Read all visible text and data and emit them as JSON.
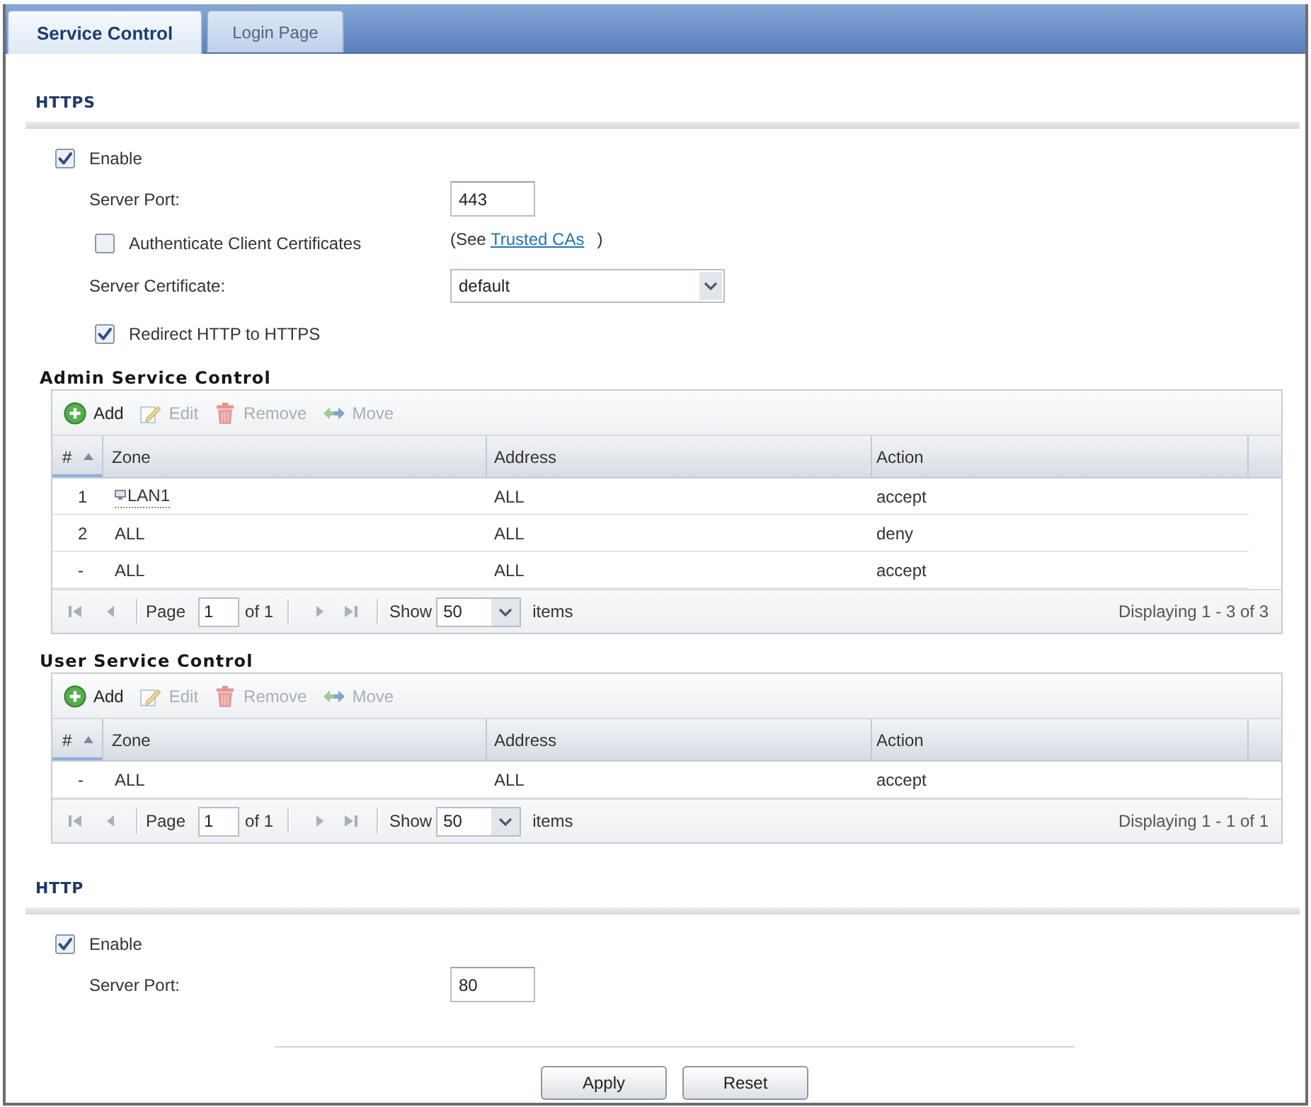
{
  "tabs": [
    {
      "label": "Service Control",
      "selected": true
    },
    {
      "label": "Login Page",
      "selected": false
    }
  ],
  "https": {
    "title": "HTTPS",
    "enable": {
      "label": "Enable",
      "checked": true
    },
    "server_port": {
      "label": "Server Port:",
      "value": "443"
    },
    "authenticate_client_certificates": {
      "label": "Authenticate Client Certificates",
      "checked": false,
      "note": {
        "prefix": "(See",
        "link": "Trusted CAs",
        "suffix": ")"
      }
    },
    "server_certificate": {
      "label": "Server Certificate:",
      "value": "default"
    },
    "redirect_http_to_https": {
      "label": "Redirect HTTP to HTTPS",
      "checked": true
    }
  },
  "admin_service_control": {
    "title": "Admin Service Control",
    "toolbar": [
      {
        "kind": "add",
        "label": "Add",
        "disabled": false
      },
      {
        "kind": "edit",
        "label": "Edit",
        "disabled": true
      },
      {
        "kind": "remove",
        "label": "Remove",
        "disabled": true
      },
      {
        "kind": "move",
        "label": "Move",
        "disabled": true
      }
    ],
    "columns": [
      {
        "label": "#",
        "sorted": true
      },
      {
        "label": "Zone",
        "sorted": false
      },
      {
        "label": "Address",
        "sorted": false
      },
      {
        "label": "Action",
        "sorted": false
      }
    ],
    "rows": [
      {
        "number": "1",
        "zone": "LAN1",
        "zone_object": true,
        "address": "ALL",
        "action": "accept"
      },
      {
        "number": "2",
        "zone": "ALL",
        "zone_object": false,
        "address": "ALL",
        "action": "deny"
      },
      {
        "number": "-",
        "zone": "ALL",
        "zone_object": false,
        "address": "ALL",
        "action": "accept"
      }
    ],
    "pager": {
      "page_label": "Page",
      "page": "1",
      "page_count": "of 1",
      "show_label": "Show",
      "show": "50",
      "items_label": "items",
      "summary": "Displaying 1 - 3 of 3"
    }
  },
  "user_service_control": {
    "title": "User Service Control",
    "toolbar": [
      {
        "kind": "add",
        "label": "Add",
        "disabled": false
      },
      {
        "kind": "edit",
        "label": "Edit",
        "disabled": true
      },
      {
        "kind": "remove",
        "label": "Remove",
        "disabled": true
      },
      {
        "kind": "move",
        "label": "Move",
        "disabled": true
      }
    ],
    "columns": [
      {
        "label": "#",
        "sorted": true
      },
      {
        "label": "Zone",
        "sorted": false
      },
      {
        "label": "Address",
        "sorted": false
      },
      {
        "label": "Action",
        "sorted": false
      }
    ],
    "rows": [
      {
        "number": "-",
        "zone": "ALL",
        "zone_object": false,
        "address": "ALL",
        "action": "accept"
      }
    ],
    "pager": {
      "page_label": "Page",
      "page": "1",
      "page_count": "of 1",
      "show_label": "Show",
      "show": "50",
      "items_label": "items",
      "summary": "Displaying 1 - 1 of 1"
    }
  },
  "http": {
    "title": "HTTP",
    "enable": {
      "label": "Enable",
      "checked": true
    },
    "server_port": {
      "label": "Server Port:",
      "value": "80"
    }
  },
  "buttons": [
    "Apply",
    "Reset"
  ]
}
